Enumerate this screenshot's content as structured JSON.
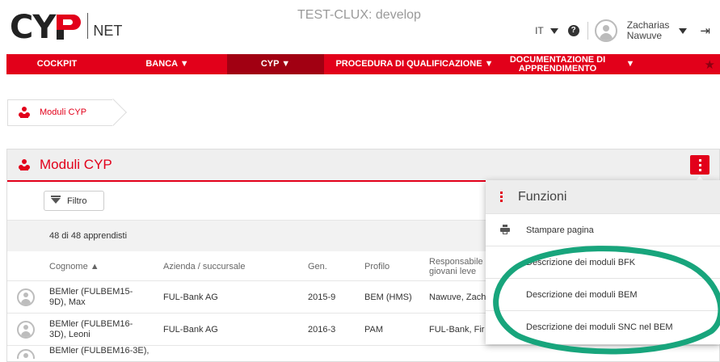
{
  "header": {
    "logo_letters": "CY",
    "logo_suffix": "NET",
    "env_title": "TEST-CLUX: develop",
    "language": "IT",
    "help_glyph": "?",
    "user_first": "Zacharias",
    "user_last": "Nawuve",
    "logout_glyph": "⇥"
  },
  "nav": {
    "items": [
      {
        "label": "COCKPIT"
      },
      {
        "label": "BANCA ▼"
      },
      {
        "label": "CYP ▼",
        "active": true
      },
      {
        "label": "PROCEDURA DI QUALIFICAZIONE ▼"
      },
      {
        "label": "DOCUMENTAZIONE DI APPRENDIMENTO"
      },
      {
        "label": "▼"
      }
    ],
    "star_glyph": "★"
  },
  "breadcrumb": {
    "label": "Moduli CYP"
  },
  "panel": {
    "title": "Moduli CYP",
    "filter_label": "Filtro",
    "count_text": "48 di 48 apprendisti"
  },
  "table": {
    "headers": {
      "surname": "Cognome ▲",
      "company": "Azienda / succursale",
      "gen": "Gen.",
      "profile": "Profilo",
      "responsible": "Responsabile giovani leve"
    },
    "rows": [
      {
        "name": "BEMler (FULBEM15-9D), Max",
        "company": "FUL-Bank AG",
        "gen": "2015-9",
        "profile": "BEM (HMS)",
        "responsible": "Nawuve, Zach"
      },
      {
        "name": "BEMler (FULBEM16-3D), Leoni",
        "company": "FUL-Bank AG",
        "gen": "2016-3",
        "profile": "PAM",
        "responsible": "FUL-Bank, Fir"
      },
      {
        "name": "BEMler (FULBEM16-3E),",
        "company": "",
        "gen": "",
        "profile": "",
        "responsible": ""
      }
    ]
  },
  "functions_menu": {
    "title": "Funzioni",
    "items": [
      {
        "label": "Stampare pagina",
        "icon": "printer-icon"
      },
      {
        "label": "Descrizione dei moduli BFK"
      },
      {
        "label": "Descrizione dei moduli BEM"
      },
      {
        "label": "Descrizione dei moduli SNC nel BEM"
      }
    ]
  },
  "colors": {
    "brand_red": "#e2001a",
    "active_nav": "#a10012",
    "annotation_green": "#18a57c"
  }
}
